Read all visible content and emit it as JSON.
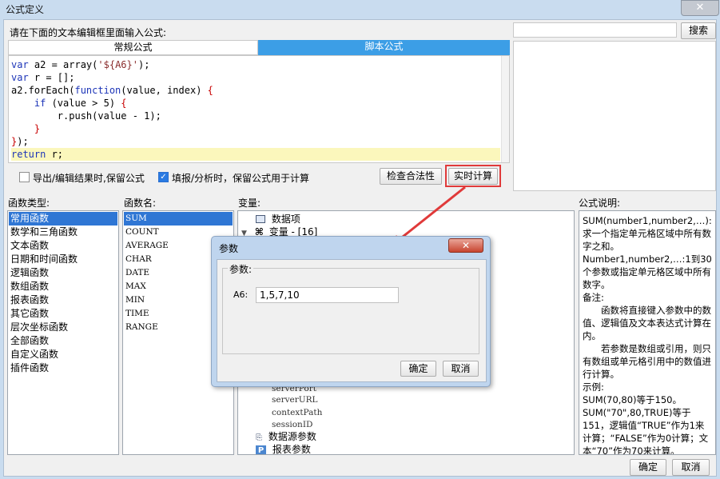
{
  "window": {
    "title": "公式定义",
    "close_glyph": "✕"
  },
  "editor_section": {
    "prompt": "请在下面的文本编辑框里面输入公式:",
    "tabs": [
      {
        "label": "常规公式"
      },
      {
        "label": "脚本公式"
      }
    ],
    "code_lines": [
      "var a2 = array('${A6}');",
      "var r = [];",
      "a2.forEach(function(value, index) {",
      "    if (value > 5) {",
      "        r.push(value - 1);",
      "    }",
      "});",
      "return r;"
    ],
    "option_export": "导出/编辑结果时,保留公式",
    "option_fill": "填报/分析时，保留公式用于计算",
    "check_button": "检查合法性",
    "realtime_button": "实时计算"
  },
  "search": {
    "button": "搜索",
    "value": ""
  },
  "function_types": {
    "label": "函数类型:",
    "items": [
      "常用函数",
      "数学和三角函数",
      "文本函数",
      "日期和时间函数",
      "逻辑函数",
      "数组函数",
      "报表函数",
      "其它函数",
      "层次坐标函数",
      "全部函数",
      "自定义函数",
      "插件函数"
    ]
  },
  "function_names": {
    "label": "函数名:",
    "items": [
      "SUM",
      "COUNT",
      "AVERAGE",
      "CHAR",
      "DATE",
      "MAX",
      "MIN",
      "TIME",
      "RANGE"
    ]
  },
  "variables": {
    "label": "变量:",
    "tree": {
      "data_items": "数据项",
      "variables": "变量 - [16]",
      "server_items": [
        "serverPort",
        "serverURL",
        "contextPath",
        "sessionID"
      ],
      "datasource_params": "数据源参数",
      "report_params": "报表参数"
    }
  },
  "description": {
    "label": "公式说明:",
    "lines": [
      "SUM(number1,number2,…): 求一个指定单元格区域中所有数字之和。",
      "Number1,number2,…:1到30个参数或指定单元格区域中所有数字。",
      "备注:",
      "函数将直接键入参数中的数值、逻辑值及文本表达式计算在内。",
      "若参数是数组或引用，则只有数组或单元格引用中的数值进行计算。",
      "示例:",
      "SUM(70,80)等于150。",
      "SUM(\"70\",80,TRUE)等于151，逻辑值“TRUE”作为1来计算；“FALSE”作为0计算；文本“70”作为70来计算。"
    ]
  },
  "popup": {
    "title": "参数",
    "group_label": "参数:",
    "param_name": "A6:",
    "param_value": "1,5,7,10",
    "ok": "确定",
    "cancel": "取消",
    "close_glyph": "✕"
  },
  "footer": {
    "ok": "确定",
    "cancel": "取消"
  },
  "colors": {
    "tab_active": "#3c9ee6",
    "selection": "#2f76d4",
    "highlight_box": "#e03a3a",
    "arrow": "#e03a3a",
    "current_line": "#fbf7bc"
  },
  "icons": {
    "window_close": "close-icon",
    "tree_expand": "expand-arrow-icon",
    "data_items": "table-icon",
    "variables": "variable-icon",
    "datasource": "datasource-icon",
    "report_params": "parameter-icon"
  }
}
